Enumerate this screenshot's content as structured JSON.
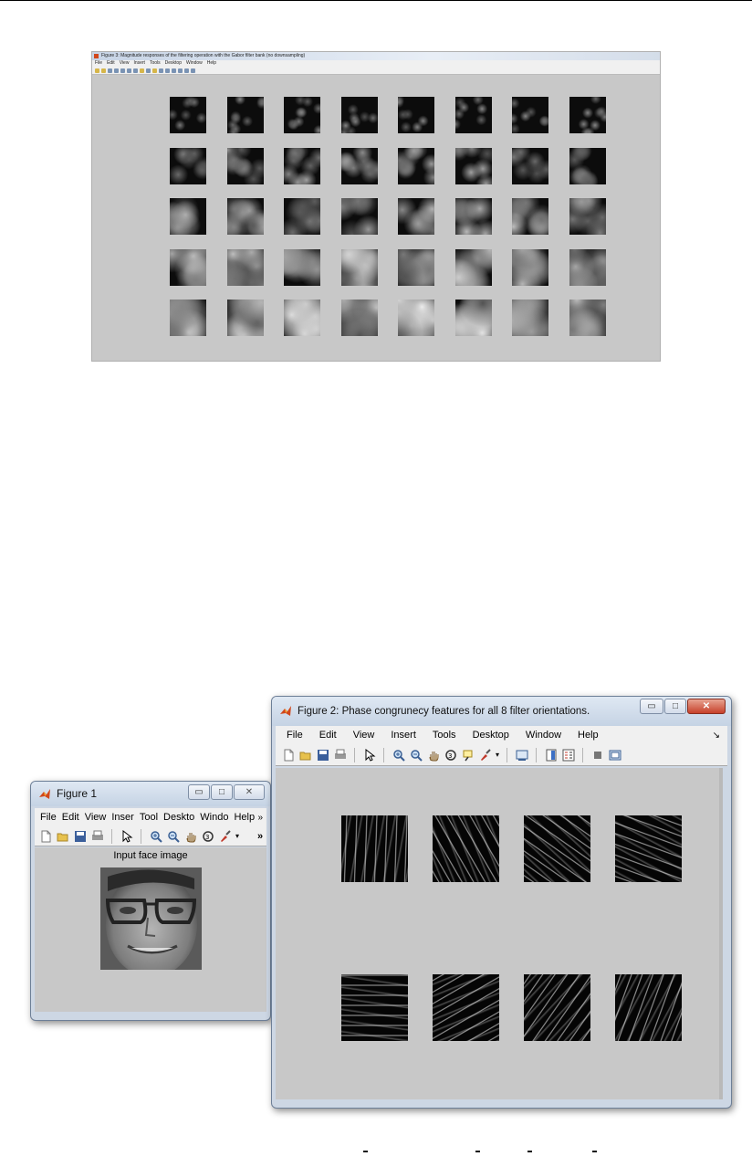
{
  "top_screenshot": {
    "title": "Figure 3: Magnitude responses of the filtering operation with the Gabor filter bank (no downsampling)",
    "menu": [
      "File",
      "Edit",
      "View",
      "Insert",
      "Tools",
      "Desktop",
      "Window",
      "Help"
    ],
    "grid": {
      "rows": 5,
      "cols": 8
    }
  },
  "figure1": {
    "title": "Figure 1",
    "menu": [
      "File",
      "Edit",
      "View",
      "Inser",
      "Tool",
      "Deskto",
      "Windo",
      "Help"
    ],
    "menu_more": "»",
    "axes_title": "Input face image",
    "toolbar_more": "»"
  },
  "figure2": {
    "title": "Figure 2: Phase congrunecy features for all 8 filter orientations.",
    "menu": [
      "File",
      "Edit",
      "View",
      "Insert",
      "Tools",
      "Desktop",
      "Window",
      "Help"
    ],
    "menu_more": "↘",
    "tiles": 8
  },
  "window_buttons": {
    "minimize": "▭",
    "maximize": "□",
    "close": "✕",
    "close_fig1": "✕"
  },
  "colors": {
    "figure_bg": "#c8c8c8",
    "chrome": "#cdd7e4",
    "close_red": "#c7402a",
    "matlab_orange": "#d1471b"
  }
}
